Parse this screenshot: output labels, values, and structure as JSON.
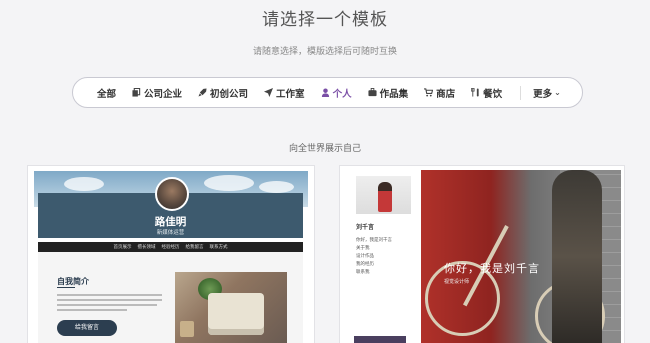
{
  "header": {
    "title": "请选择一个模板",
    "subtitle": "请随意选择，模版选择后可随时互换"
  },
  "nav": {
    "items": [
      {
        "label": "全部",
        "icon": "",
        "active": false
      },
      {
        "label": "公司企业",
        "icon": "copy-icon",
        "active": false
      },
      {
        "label": "初创公司",
        "icon": "rocket-icon",
        "active": false
      },
      {
        "label": "工作室",
        "icon": "send-icon",
        "active": false
      },
      {
        "label": "个人",
        "icon": "user-icon",
        "active": true
      },
      {
        "label": "作品集",
        "icon": "briefcase-icon",
        "active": false
      },
      {
        "label": "商店",
        "icon": "cart-icon",
        "active": false
      },
      {
        "label": "餐饮",
        "icon": "cutlery-icon",
        "active": false
      }
    ],
    "more_label": "更多",
    "accent": "#7a4fa6"
  },
  "section": {
    "label": "向全世界展示自己"
  },
  "templates": [
    {
      "name": "路佳明",
      "role": "新媒体运营",
      "menu": [
        "首页展示",
        "擅长领域",
        "经验经历",
        "给我留言",
        "联系方式"
      ],
      "about_heading": "自我简介",
      "button_label": "给我留言"
    },
    {
      "name": "刘千言",
      "nav": [
        "你好，我是刘千言",
        "关于我",
        "设计作品",
        "我的经历",
        "联系我"
      ],
      "hero_title": "你好，我是刘千言",
      "hero_sub": "视觉设计师"
    }
  ]
}
